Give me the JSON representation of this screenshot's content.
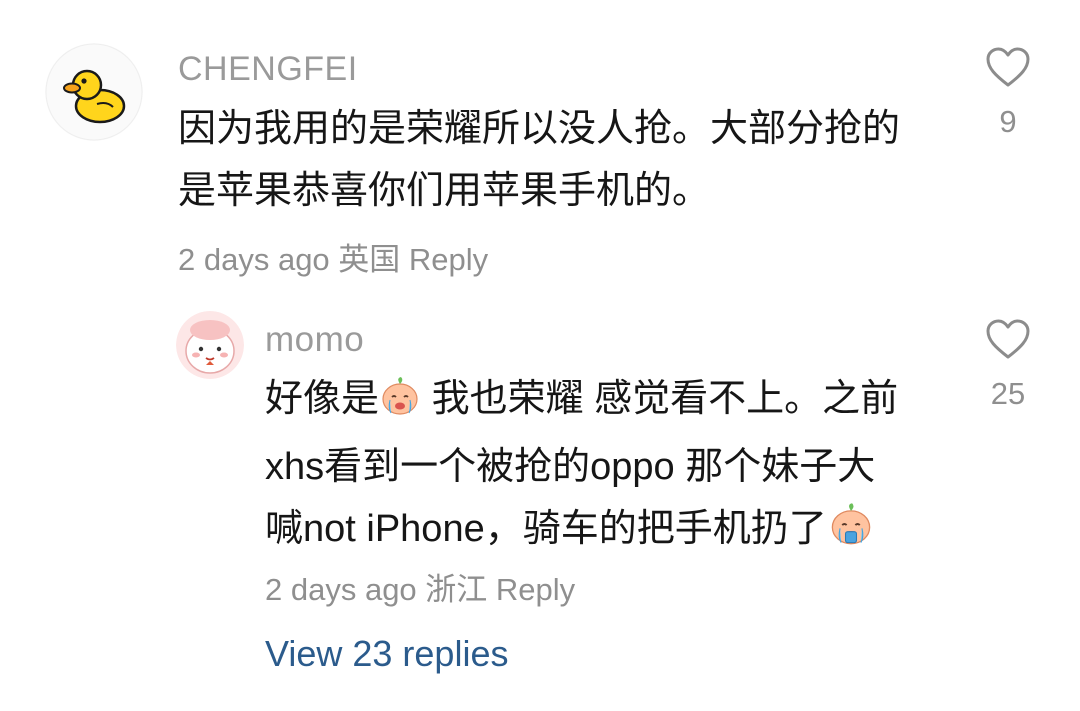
{
  "comments": [
    {
      "username": "CHENGFEI",
      "avatar_icon": "duck-icon",
      "lines": [
        "因为我用的是荣耀所以没人抢。大部分抢的",
        "是苹果恭喜你们用苹果手机的。"
      ],
      "time": "2 days ago",
      "location": "英国",
      "reply_label": "Reply",
      "likes": "9"
    }
  ],
  "replies": [
    {
      "username": "momo",
      "avatar_icon": "pink-character-avatar-icon",
      "line1_a": "好像是",
      "line1_b": " 我也荣耀 感觉看不上。之前",
      "line2": "xhs看到一个被抢的oppo 那个妹子大",
      "line3": "喊not iPhone，骑车的把手机扔了",
      "emoji_icon": "crying-peach-emoji-icon",
      "time": "2 days ago",
      "location": "浙江",
      "reply_label": "Reply",
      "likes": "25"
    }
  ],
  "view_replies_label": "View 23 replies",
  "colors": {
    "username": "#9a9a9a",
    "meta": "#8f8f8f",
    "link": "#2b5b8c",
    "duck": "#ffd51c"
  }
}
